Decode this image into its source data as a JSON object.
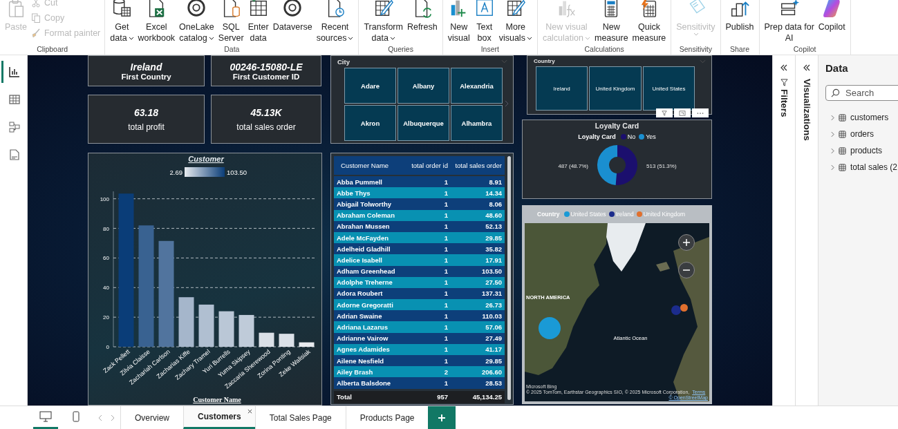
{
  "ribbon": {
    "groups": [
      {
        "label": "Clipboard",
        "buttons": [
          {
            "kind": "large",
            "lines": [
              "Paste"
            ],
            "dropdown": false,
            "disabled": true
          },
          {
            "kind": "small",
            "lines": [
              "Cut"
            ],
            "dropdown": false,
            "disabled": true
          },
          {
            "kind": "small",
            "lines": [
              "Copy"
            ],
            "dropdown": false,
            "disabled": true
          },
          {
            "kind": "small",
            "lines": [
              "Format painter"
            ],
            "dropdown": false,
            "disabled": true
          }
        ]
      },
      {
        "label": "Data",
        "buttons": [
          {
            "kind": "large",
            "lines": [
              "Get",
              "data"
            ],
            "dropdown": true,
            "disabled": false
          },
          {
            "kind": "large",
            "lines": [
              "Excel",
              "workbook"
            ],
            "dropdown": false,
            "disabled": false
          },
          {
            "kind": "large",
            "lines": [
              "OneLake",
              "catalog"
            ],
            "dropdown": true,
            "disabled": false
          },
          {
            "kind": "large",
            "lines": [
              "SQL",
              "Server"
            ],
            "dropdown": false,
            "disabled": false
          },
          {
            "kind": "large",
            "lines": [
              "Enter",
              "data"
            ],
            "dropdown": false,
            "disabled": false
          },
          {
            "kind": "large",
            "lines": [
              "Dataverse"
            ],
            "dropdown": false,
            "disabled": false
          },
          {
            "kind": "large",
            "lines": [
              "Recent",
              "sources"
            ],
            "dropdown": true,
            "disabled": false
          }
        ]
      },
      {
        "label": "Queries",
        "buttons": [
          {
            "kind": "large",
            "lines": [
              "Transform",
              "data"
            ],
            "dropdown": true,
            "disabled": false
          },
          {
            "kind": "large",
            "lines": [
              "Refresh"
            ],
            "dropdown": false,
            "disabled": false
          }
        ]
      },
      {
        "label": "Insert",
        "buttons": [
          {
            "kind": "large",
            "lines": [
              "New",
              "visual"
            ],
            "dropdown": false,
            "disabled": false
          },
          {
            "kind": "large",
            "lines": [
              "Text",
              "box"
            ],
            "dropdown": false,
            "disabled": false
          },
          {
            "kind": "large",
            "lines": [
              "More",
              "visuals"
            ],
            "dropdown": true,
            "disabled": false
          }
        ]
      },
      {
        "label": "Calculations",
        "buttons": [
          {
            "kind": "large",
            "lines": [
              "New visual",
              "calculation"
            ],
            "dropdown": true,
            "disabled": true
          },
          {
            "kind": "large",
            "lines": [
              "New",
              "measure"
            ],
            "dropdown": false,
            "disabled": false
          },
          {
            "kind": "large",
            "lines": [
              "Quick",
              "measure"
            ],
            "dropdown": false,
            "disabled": false
          }
        ]
      },
      {
        "label": "Sensitivity",
        "buttons": [
          {
            "kind": "large",
            "lines": [
              "Sensitivity"
            ],
            "dropdown": true,
            "disabled": true
          }
        ]
      },
      {
        "label": "Share",
        "buttons": [
          {
            "kind": "large",
            "lines": [
              "Publish"
            ],
            "dropdown": false,
            "disabled": false
          }
        ]
      },
      {
        "label": "Copilot",
        "buttons": [
          {
            "kind": "large",
            "lines": [
              "Prep data for",
              "AI"
            ],
            "dropdown": false,
            "disabled": false
          },
          {
            "kind": "large",
            "lines": [
              "Copilot"
            ],
            "dropdown": false,
            "disabled": false
          }
        ]
      }
    ]
  },
  "view_rail": [
    {
      "selected": true
    },
    {
      "selected": false
    },
    {
      "selected": false
    },
    {
      "selected": false
    }
  ],
  "cards": [
    {
      "value": "Ireland",
      "label": "First Country"
    },
    {
      "value": "00246-15080-LE",
      "label": "First Customer ID"
    },
    {
      "value": "63.18",
      "label": "total profit"
    },
    {
      "value": "45.13K",
      "label": "total sales order"
    }
  ],
  "bar_visual": {
    "color_scale": {
      "min": "2.69",
      "max": "103.50"
    },
    "chart_data": {
      "type": "bar",
      "title": "Customer",
      "xlabel": "Customer Name",
      "categories": [
        "Zack Pellett",
        "Zilvia Claisse",
        "Zachariah Carlson",
        "Zacharias Kiffe",
        "Zachary Tramel",
        "Yuri Burrells",
        "Yuma Skipsey",
        "Zaccaria Sherewood",
        "Zorina Ponting",
        "Zeke Walisiak"
      ],
      "values": [
        103.5,
        82,
        71.5,
        33.5,
        28.5,
        24,
        21.5,
        9.5,
        8.8,
        3
      ],
      "ylim": [
        0,
        105
      ],
      "yticks": [
        0,
        20,
        40,
        60,
        80,
        100
      ],
      "grid": true
    }
  },
  "city_slicer": {
    "title": "City",
    "items": [
      {
        "label": "Adare",
        "selected": false
      },
      {
        "label": "Albany",
        "selected": false
      },
      {
        "label": "Alexandria",
        "selected": false
      },
      {
        "label": "Akron",
        "selected": false
      },
      {
        "label": "Albuquerque",
        "selected": false
      },
      {
        "label": "Alhambra",
        "selected": false
      }
    ]
  },
  "table": {
    "columns": [
      "Customer Name",
      "total order id",
      "total sales order"
    ],
    "rows": [
      [
        "Abba Pummell",
        "1",
        "8.91"
      ],
      [
        "Abbe Thys",
        "1",
        "14.34"
      ],
      [
        "Abigail Tolworthy",
        "1",
        "8.06"
      ],
      [
        "Abraham Coleman",
        "1",
        "48.60"
      ],
      [
        "Abrahan Mussen",
        "1",
        "52.13"
      ],
      [
        "Adele McFayden",
        "1",
        "29.85"
      ],
      [
        "Adelheid Gladhill",
        "1",
        "35.82"
      ],
      [
        "Adelice Isabell",
        "1",
        "17.91"
      ],
      [
        "Adham Greenhead",
        "1",
        "103.50"
      ],
      [
        "Adolphe Treherne",
        "1",
        "27.50"
      ],
      [
        "Adora Roubert",
        "1",
        "137.31"
      ],
      [
        "Adorne Gregoratti",
        "1",
        "26.73"
      ],
      [
        "Adrian Swaine",
        "1",
        "110.03"
      ],
      [
        "Adriana Lazarus",
        "1",
        "57.06"
      ],
      [
        "Adrianne Vairow",
        "1",
        "27.49"
      ],
      [
        "Agnes Adamides",
        "1",
        "41.17"
      ],
      [
        "Ailene Nesfield",
        "1",
        "29.85"
      ],
      [
        "Ailey Brash",
        "2",
        "206.60"
      ],
      [
        "Alberta Balsdone",
        "1",
        "28.53"
      ]
    ],
    "total": [
      "Total",
      "957",
      "45,134.25"
    ]
  },
  "country_slicer": {
    "title": "Country",
    "items": [
      {
        "label": "Ireland",
        "selected": false
      },
      {
        "label": "United Kingdom",
        "selected": false
      },
      {
        "label": "United States",
        "selected": false
      }
    ]
  },
  "loyalty": {
    "title": "Loyalty Card",
    "legend": {
      "title": "Loyalty Card",
      "items": [
        {
          "color": "#1b0f6e"
        },
        {
          "color": "#1a8fd0"
        }
      ]
    },
    "chart_data": {
      "type": "donut",
      "categories": [
        "No",
        "Yes"
      ],
      "values": [
        513,
        487
      ],
      "value_labels": [
        "513 (51.3%)",
        "487 (48.7%)"
      ]
    }
  },
  "map": {
    "legend": {
      "title": "Country",
      "items": [
        {
          "label": "United States",
          "color": "#1a9ad6"
        },
        {
          "label": "Ireland",
          "color": "#1c2c8c"
        },
        {
          "label": "United Kingdom",
          "color": "#e0702e"
        }
      ]
    },
    "labels": [
      "NORTH AMERICA",
      "Atlantic Ocean"
    ],
    "attribution": "© 2025 TomTom, Earthstar Geographics SIO, © 2025 Microsoft Corporation,",
    "terms": "Terms",
    "osm": "© OpenStreetMap",
    "brand": "Microsoft Bing"
  },
  "panes": {
    "filters": "Filters",
    "visualizations": "Visualizations",
    "data": {
      "title": "Data",
      "search_placeholder": "Search",
      "items": [
        "customers",
        "orders",
        "products",
        "total sales (2"
      ]
    }
  },
  "pages": {
    "tabs": [
      {
        "label": "Overview",
        "selected": false
      },
      {
        "label": "Customers",
        "selected": true
      },
      {
        "label": "Total Sales Page",
        "selected": false
      },
      {
        "label": "Products Page",
        "selected": false
      }
    ],
    "layouts": [
      {
        "selected": true
      },
      {
        "selected": false
      }
    ]
  }
}
